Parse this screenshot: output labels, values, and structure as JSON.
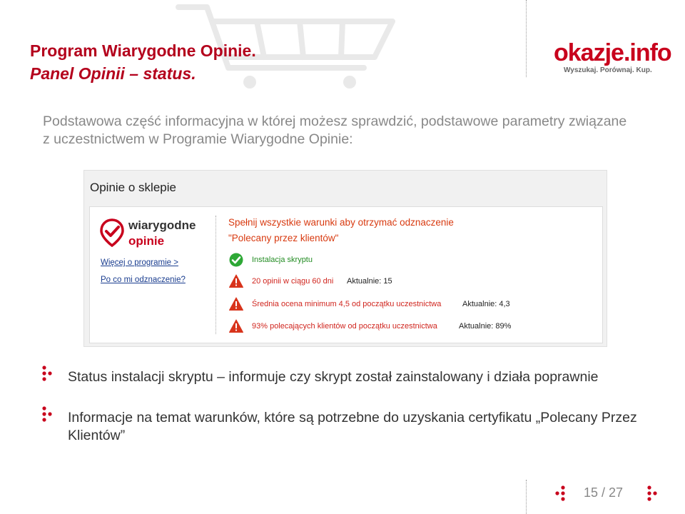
{
  "slide": {
    "title_line1": "Program Wiarygodne Opinie.",
    "title_line2": "Panel Opinii – status.",
    "intro": "Podstawowa część informacyjna w której możesz sprawdzić, podstawowe parametry związane z uczestnictwem w Programie Wiarygodne Opinie:"
  },
  "logo": {
    "name": "okazje.info",
    "tagline": "Wyszukaj. Porównaj. Kup."
  },
  "screenshot": {
    "title": "Opinie o sklepie",
    "program_logo": {
      "word1": "wiarygodne",
      "word2": "opinie"
    },
    "links": [
      "Więcej o programie >",
      "Po co mi odznaczenie?"
    ],
    "heading_line1": "Spełnij wszystkie warunki aby otrzymać odznaczenie",
    "heading_line2": "\"Polecany przez klientów\"",
    "conditions": [
      {
        "icon": "check-icon",
        "label": "Instalacja skryptu",
        "current": ""
      },
      {
        "icon": "warning-icon",
        "label": "20 opinii w ciągu 60 dni",
        "current": "Aktualnie: 15"
      },
      {
        "icon": "warning-icon",
        "label": "Średnia ocena minimum 4,5 od początku uczestnictwa",
        "current": "Aktualnie: 4,3"
      },
      {
        "icon": "warning-icon",
        "label": "93% polecających klientów od początku uczestnictwa",
        "current": "Aktualnie: 89%"
      }
    ]
  },
  "bullets": [
    "Status instalacji skryptu – informuje czy skrypt został zainstalowany i działa poprawnie",
    "Informacje na temat warunków, które są potrzebne do uzyskania certyfikatu „Polecany Przez Klientów”"
  ],
  "footer": {
    "page": "15 / 27"
  },
  "colors": {
    "title": "#b4001c",
    "brand_red": "#c8001c",
    "ok_green": "#238c23",
    "warn_red": "#d0251e",
    "heading_orange": "#d83a10"
  }
}
